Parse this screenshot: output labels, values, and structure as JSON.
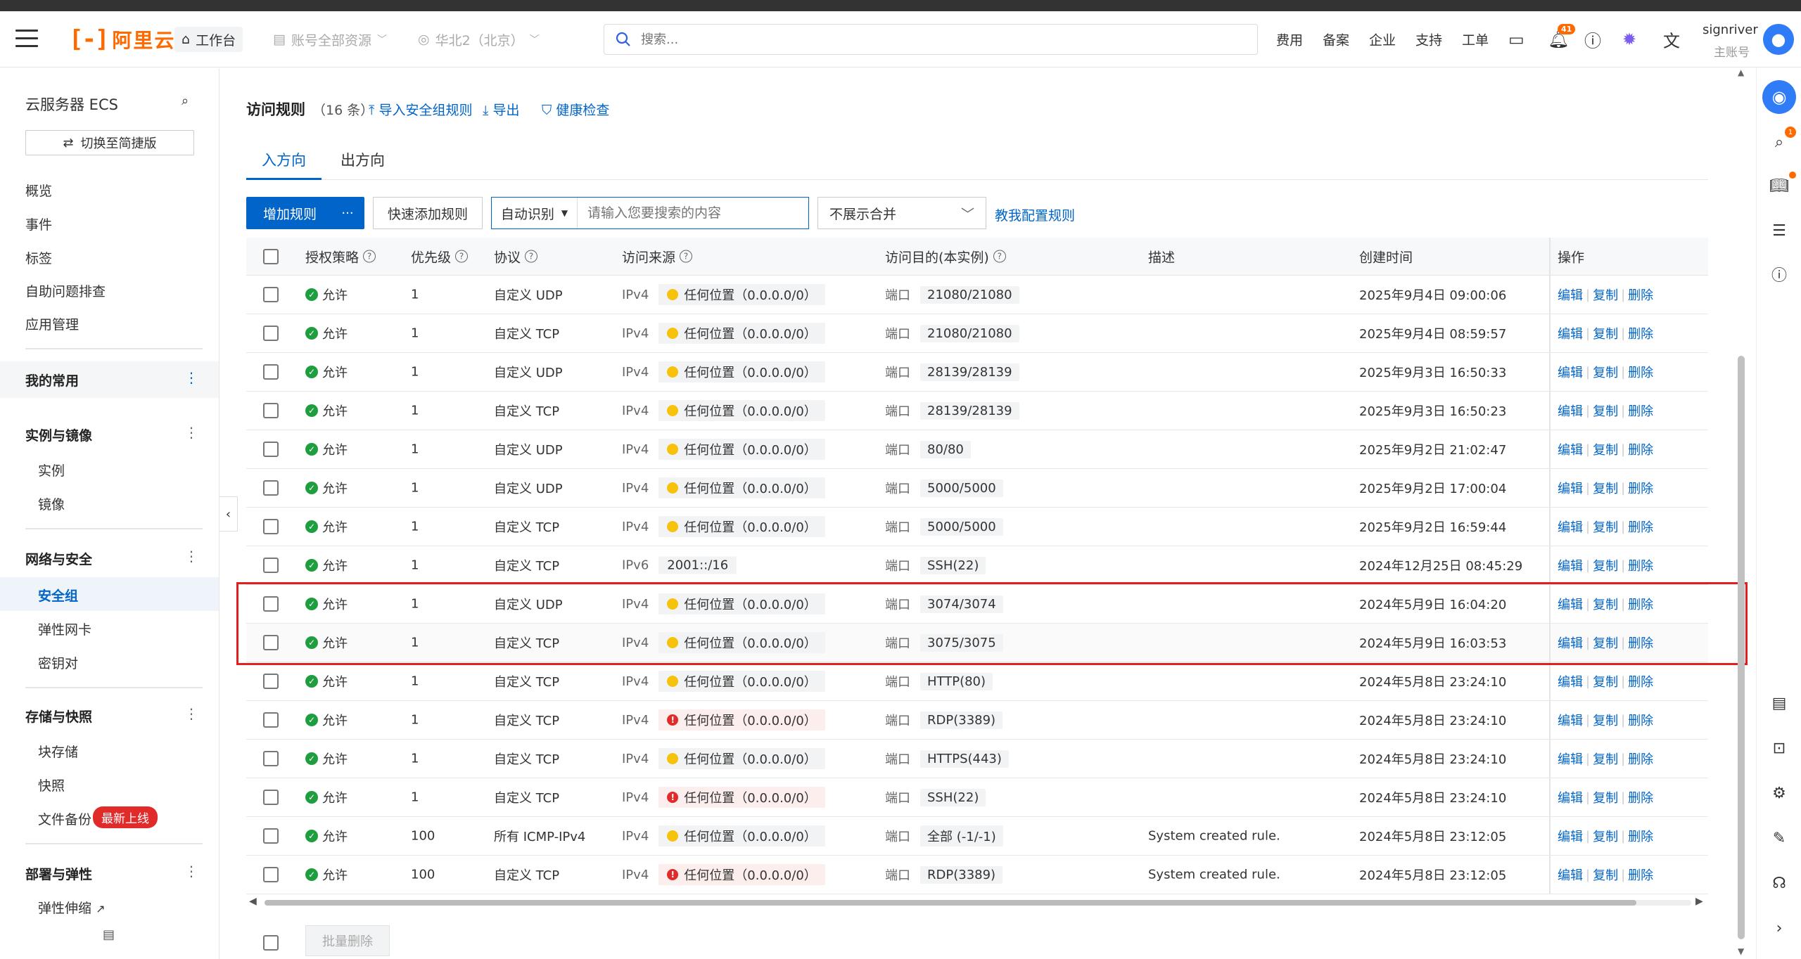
{
  "header": {
    "logo_mark": "[-]",
    "logo_text": "阿里云",
    "workbench": "工作台",
    "account_scope": "账号全部资源",
    "region": "华北2（北京）",
    "search_placeholder": "搜索...",
    "links": [
      "费用",
      "备案",
      "企业",
      "支持",
      "工单"
    ],
    "bell_count": "41",
    "user_name": "signriver",
    "user_role": "主账号"
  },
  "sidebar": {
    "title": "云服务器 ECS",
    "switch_label": "切换至简捷版",
    "top_items": [
      "概览",
      "事件",
      "标签",
      "自助问题排查",
      "应用管理"
    ],
    "mine_group": "我的常用",
    "groups": [
      {
        "title": "实例与镜像",
        "items": [
          "实例",
          "镜像"
        ]
      },
      {
        "title": "网络与安全",
        "items": [
          "安全组",
          "弹性网卡",
          "密钥对"
        ]
      },
      {
        "title": "存储与快照",
        "items": [
          "块存储",
          "快照",
          "文件备份"
        ]
      },
      {
        "title": "部署与弹性",
        "items": [
          "弹性伸缩"
        ]
      }
    ],
    "new_badge": "最新上线"
  },
  "main": {
    "title": "访问规则",
    "count": "（16 条）",
    "import_link": "导入安全组规则",
    "export_link": "导出",
    "health_link": "健康检查",
    "tabs": [
      "入方向",
      "出方向"
    ],
    "add_rule": "增加规则",
    "more": "···",
    "quick_add": "快速添加规则",
    "filter_mode": "自动识别",
    "filter_placeholder": "请输入您要搜索的内容",
    "merge_select": "不展示合并",
    "teach_link": "教我配置规则",
    "batch_delete": "批量删除"
  },
  "table": {
    "headers": [
      "授权策略",
      "优先级",
      "协议",
      "访问来源",
      "访问目的(本实例)",
      "描述",
      "创建时间",
      "操作"
    ],
    "actions": [
      "编辑",
      "复制",
      "删除"
    ],
    "port_label": "端口",
    "rows": [
      {
        "policy": "允许",
        "priority": "1",
        "protocol": "自定义 UDP",
        "ipver": "IPv4",
        "source": "任何位置（0.0.0.0/0）",
        "risk": "warn",
        "port": "21080/21080",
        "desc": "",
        "created": "2025年9月4日 09:00:06"
      },
      {
        "policy": "允许",
        "priority": "1",
        "protocol": "自定义 TCP",
        "ipver": "IPv4",
        "source": "任何位置（0.0.0.0/0）",
        "risk": "warn",
        "port": "21080/21080",
        "desc": "",
        "created": "2025年9月4日 08:59:57"
      },
      {
        "policy": "允许",
        "priority": "1",
        "protocol": "自定义 UDP",
        "ipver": "IPv4",
        "source": "任何位置（0.0.0.0/0）",
        "risk": "warn",
        "port": "28139/28139",
        "desc": "",
        "created": "2025年9月3日 16:50:33"
      },
      {
        "policy": "允许",
        "priority": "1",
        "protocol": "自定义 TCP",
        "ipver": "IPv4",
        "source": "任何位置（0.0.0.0/0）",
        "risk": "warn",
        "port": "28139/28139",
        "desc": "",
        "created": "2025年9月3日 16:50:23"
      },
      {
        "policy": "允许",
        "priority": "1",
        "protocol": "自定义 UDP",
        "ipver": "IPv4",
        "source": "任何位置（0.0.0.0/0）",
        "risk": "warn",
        "port": "80/80",
        "desc": "",
        "created": "2025年9月2日 21:02:47"
      },
      {
        "policy": "允许",
        "priority": "1",
        "protocol": "自定义 UDP",
        "ipver": "IPv4",
        "source": "任何位置（0.0.0.0/0）",
        "risk": "warn",
        "port": "5000/5000",
        "desc": "",
        "created": "2025年9月2日 17:00:04"
      },
      {
        "policy": "允许",
        "priority": "1",
        "protocol": "自定义 TCP",
        "ipver": "IPv4",
        "source": "任何位置（0.0.0.0/0）",
        "risk": "warn",
        "port": "5000/5000",
        "desc": "",
        "created": "2025年9月2日 16:59:44"
      },
      {
        "policy": "允许",
        "priority": "1",
        "protocol": "自定义 TCP",
        "ipver": "IPv6",
        "source": "2001::/16",
        "risk": "none",
        "port": "SSH(22)",
        "desc": "",
        "created": "2024年12月25日 08:45:29"
      },
      {
        "policy": "允许",
        "priority": "1",
        "protocol": "自定义 UDP",
        "ipver": "IPv4",
        "source": "任何位置（0.0.0.0/0）",
        "risk": "warn",
        "port": "3074/3074",
        "desc": "",
        "created": "2024年5月9日 16:04:20"
      },
      {
        "policy": "允许",
        "priority": "1",
        "protocol": "自定义 TCP",
        "ipver": "IPv4",
        "source": "任何位置（0.0.0.0/0）",
        "risk": "warn",
        "port": "3075/3075",
        "desc": "",
        "created": "2024年5月9日 16:03:53"
      },
      {
        "policy": "允许",
        "priority": "1",
        "protocol": "自定义 TCP",
        "ipver": "IPv4",
        "source": "任何位置（0.0.0.0/0）",
        "risk": "warn",
        "port": "HTTP(80)",
        "desc": "",
        "created": "2024年5月8日 23:24:10"
      },
      {
        "policy": "允许",
        "priority": "1",
        "protocol": "自定义 TCP",
        "ipver": "IPv4",
        "source": "任何位置（0.0.0.0/0）",
        "risk": "high",
        "port": "RDP(3389)",
        "desc": "",
        "created": "2024年5月8日 23:24:10"
      },
      {
        "policy": "允许",
        "priority": "1",
        "protocol": "自定义 TCP",
        "ipver": "IPv4",
        "source": "任何位置（0.0.0.0/0）",
        "risk": "warn",
        "port": "HTTPS(443)",
        "desc": "",
        "created": "2024年5月8日 23:24:10"
      },
      {
        "policy": "允许",
        "priority": "1",
        "protocol": "自定义 TCP",
        "ipver": "IPv4",
        "source": "任何位置（0.0.0.0/0）",
        "risk": "high",
        "port": "SSH(22)",
        "desc": "",
        "created": "2024年5月8日 23:24:10"
      },
      {
        "policy": "允许",
        "priority": "100",
        "protocol": "所有 ICMP-IPv4",
        "ipver": "IPv4",
        "source": "任何位置（0.0.0.0/0）",
        "risk": "warn",
        "port": "全部 (-1/-1)",
        "desc": "System created rule.",
        "created": "2024年5月8日 23:12:05"
      },
      {
        "policy": "允许",
        "priority": "100",
        "protocol": "自定义 TCP",
        "ipver": "IPv4",
        "source": "任何位置（0.0.0.0/0）",
        "risk": "high",
        "port": "RDP(3389)",
        "desc": "System created rule.",
        "created": "2024年5月8日 23:12:05"
      }
    ]
  },
  "colors": {
    "accent": "#0064c8",
    "brand": "#ff6a00",
    "highlight_box": "#e02020",
    "allow": "#1e9e3e"
  }
}
